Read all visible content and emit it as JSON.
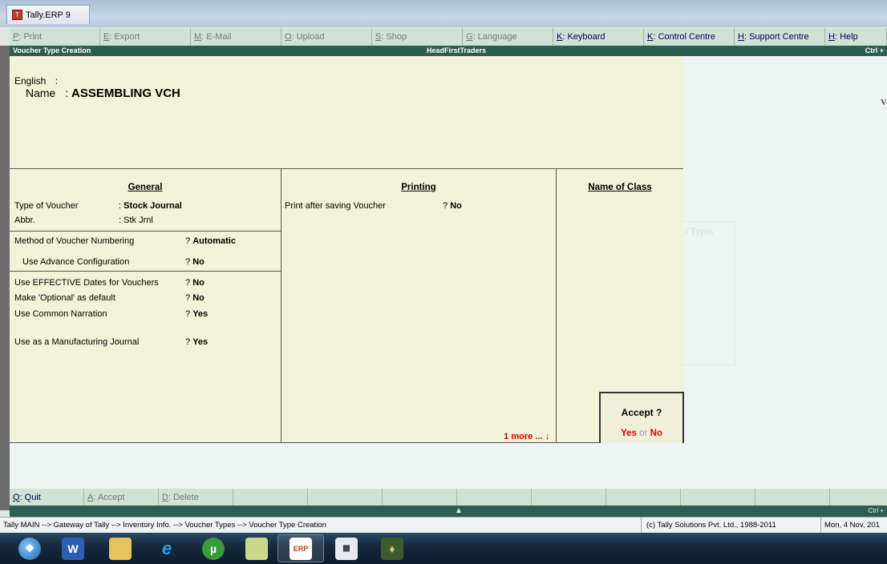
{
  "window": {
    "title": "Tally.ERP 9"
  },
  "toolbar": [
    {
      "key": "P",
      "label": ": Print",
      "enabled": false
    },
    {
      "key": "E",
      "label": ": Export",
      "enabled": false
    },
    {
      "key": "M",
      "label": ": E-Mail",
      "enabled": false
    },
    {
      "key": "O",
      "label": ": Upload",
      "enabled": false
    },
    {
      "key": "S",
      "label": ": Shop",
      "enabled": false
    },
    {
      "key": "G",
      "label": ": Language",
      "enabled": false
    },
    {
      "key": "K",
      "label": ": Keyboard",
      "enabled": true
    },
    {
      "key": "K",
      "label": ": Control Centre",
      "enabled": true
    },
    {
      "key": "H",
      "label": ": Support Centre",
      "enabled": true
    },
    {
      "key": "H",
      "label": ": Help",
      "enabled": true
    }
  ],
  "header": {
    "screen": "Voucher Type Creation",
    "company": "HeadFirstTraders",
    "shortcut": "Ctrl +"
  },
  "form": {
    "english_label": "English",
    "name_label": "Name",
    "name_value": "ASSEMBLING VCH",
    "general": {
      "heading": "General",
      "type_label": "Type of Voucher",
      "type_value": "Stock Journal",
      "abbr_label": "Abbr.",
      "abbr_value": "Stk Jrnl",
      "numbering_label": "Method of Voucher Numbering",
      "numbering_value": "Automatic",
      "adv_config_label": "Use Advance Configuration",
      "adv_config_value": "No",
      "effective_label": "Use EFFECTIVE Dates for Vouchers",
      "effective_value": "No",
      "optional_label": "Make 'Optional' as default",
      "optional_value": "No",
      "narration_label": "Use Common Narration",
      "narration_value": "Yes",
      "manufacturing_label": "Use as a Manufacturing Journal",
      "manufacturing_value": "Yes"
    },
    "printing": {
      "heading": "Printing",
      "print_label": "Print after saving Voucher",
      "print_value": "No",
      "more": "1 more ... ↓"
    },
    "class": {
      "heading": "Name of Class"
    }
  },
  "accept_dialog": {
    "question": "Accept ?",
    "yes": "Yes",
    "or": "or",
    "no": "No"
  },
  "bottom_buttons": [
    {
      "key": "Q",
      "label": ": Quit",
      "enabled": true
    },
    {
      "key": "A",
      "label": ": Accept",
      "enabled": false
    },
    {
      "key": "D",
      "label": ": Delete",
      "enabled": false
    }
  ],
  "status": {
    "path": "Tally MAIN --> Gateway of Tally --> Inventory Info. --> Voucher Types --> Voucher Type Creation",
    "copyright": "(c) Tally Solutions Pvt. Ltd., 1988-2011",
    "date": "Mon, 4 Nov, 201"
  },
  "background_ghost": {
    "types_text": "r Types",
    "right_letter": "V"
  },
  "taskbar": [
    "start-orb-icon",
    "word-icon",
    "file-explorer-icon",
    "internet-explorer-icon",
    "utorrent-icon",
    "notepad-icon",
    "tally-erp-icon",
    "calculator-icon",
    "app-icon"
  ]
}
